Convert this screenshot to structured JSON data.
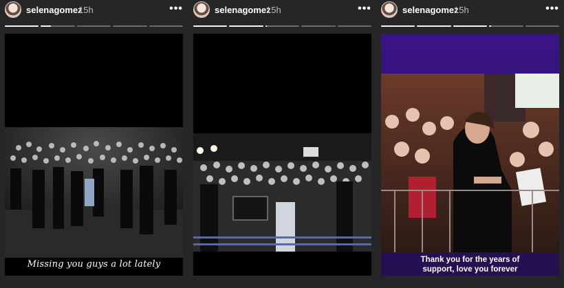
{
  "stories": [
    {
      "username": "selenagomez",
      "timestamp": "15h",
      "more_icon": "more-horizontal-icon",
      "segments": [
        1,
        0.3,
        0,
        0,
        0
      ],
      "caption": "Missing you guys a lot lately"
    },
    {
      "username": "selenagomez",
      "timestamp": "15h",
      "more_icon": "more-horizontal-icon",
      "segments": [
        1,
        1,
        0.05,
        0,
        0
      ],
      "caption": ""
    },
    {
      "username": "selenagomez",
      "timestamp": "15h",
      "more_icon": "more-horizontal-icon",
      "segments": [
        1,
        1,
        1,
        0.05,
        0
      ],
      "caption": "Thank you for the years of support, love you forever"
    }
  ],
  "colors": {
    "background": "#262626",
    "progress_track": "#6a6a6a",
    "progress_fill": "#f5f5f5",
    "story3_background": "#2a0f63"
  }
}
